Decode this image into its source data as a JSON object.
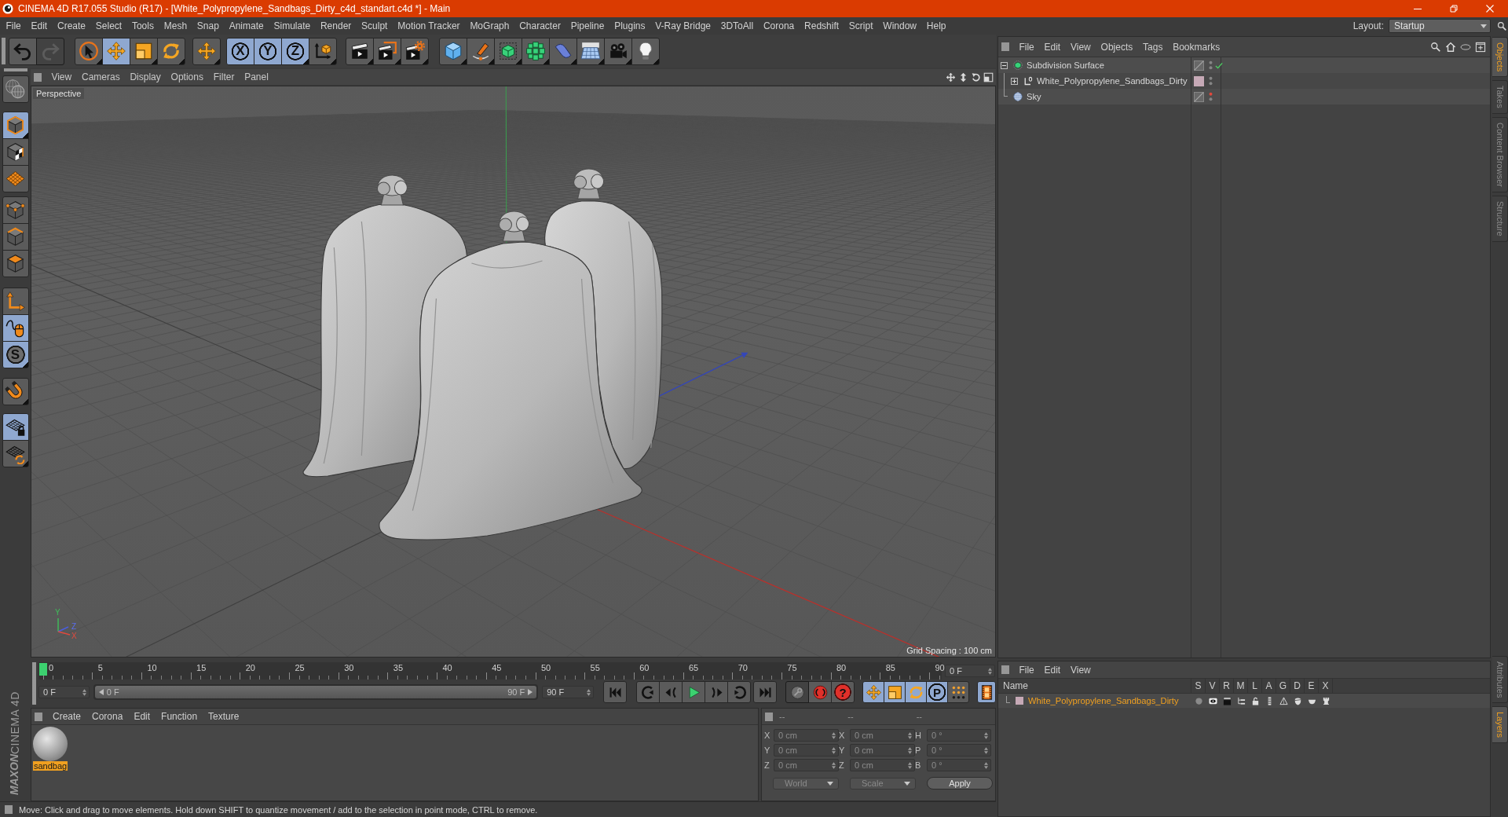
{
  "window": {
    "title": "CINEMA 4D R17.055 Studio (R17) - [White_Polypropylene_Sandbags_Dirty_c4d_standart.c4d *] - Main"
  },
  "menu_bar": {
    "items": [
      "File",
      "Edit",
      "Create",
      "Select",
      "Tools",
      "Mesh",
      "Snap",
      "Animate",
      "Simulate",
      "Render",
      "Sculpt",
      "Motion Tracker",
      "MoGraph",
      "Character",
      "Pipeline",
      "Plugins",
      "V-Ray Bridge",
      "3DToAll",
      "Corona",
      "Redshift",
      "Script",
      "Window",
      "Help"
    ],
    "layout_label": "Layout:",
    "layout_value": "Startup"
  },
  "toolbar": {
    "groups": [
      {
        "buttons": [
          {
            "disabled": false
          },
          {
            "disabled": true
          }
        ]
      },
      {
        "buttons": [
          {
            "selected": false
          },
          {
            "selected": true
          },
          {
            "selected": false
          },
          {
            "selected": false
          }
        ]
      },
      {
        "buttons": [
          {
            "selected": false
          }
        ]
      },
      {
        "buttons": [
          {
            "label": "X",
            "selected": true
          },
          {
            "label": "Y",
            "selected": true
          },
          {
            "label": "Z",
            "selected": true
          },
          {
            "selected": false
          }
        ]
      },
      {
        "buttons": [
          {
            "selected": false
          },
          {
            "selected": false
          },
          {
            "selected": false
          }
        ]
      },
      {
        "buttons": [
          {
            "selected": false
          },
          {
            "selected": false
          },
          {
            "selected": false
          },
          {
            "selected": false
          },
          {
            "selected": false
          },
          {
            "selected": false
          },
          {
            "selected": false
          },
          {
            "selected": false
          }
        ]
      }
    ]
  },
  "palette": {
    "groups": [
      {
        "buttons": [
          {
            "selected": false
          }
        ]
      },
      {
        "buttons": [
          {
            "selected": true
          },
          {
            "selected": false
          },
          {
            "selected": false
          }
        ]
      },
      {
        "buttons": [
          {
            "selected": false
          },
          {
            "selected": false
          },
          {
            "selected": false
          }
        ]
      },
      {
        "buttons": [
          {
            "selected": false
          },
          {
            "selected": true
          },
          {
            "label": "S",
            "selected": true
          }
        ]
      },
      {
        "buttons": [
          {
            "selected": false
          }
        ]
      },
      {
        "buttons": [
          {
            "selected": true
          },
          {
            "selected": false
          }
        ]
      }
    ]
  },
  "logo": {
    "brand": "MAXON",
    "product": "CINEMA 4D"
  },
  "viewport": {
    "menu": [
      "View",
      "Cameras",
      "Display",
      "Options",
      "Filter",
      "Panel"
    ],
    "camera": "Perspective",
    "grid_spacing": "Grid Spacing : 100 cm",
    "axis_labels": [
      "Y",
      "Z",
      "X"
    ]
  },
  "timeline": {
    "ticks": [
      "0",
      "5",
      "10",
      "15",
      "20",
      "25",
      "30",
      "35",
      "40",
      "45",
      "50",
      "55",
      "60",
      "65",
      "70",
      "75",
      "80",
      "85",
      "90"
    ],
    "playhead": {
      "level": 0
    },
    "frame": "0 F"
  },
  "playback": {
    "current": "0 F",
    "range": {
      "start": "0 F",
      "end": "90 F",
      "level": 1
    },
    "end": "90 F",
    "record": [
      {
        "disabled": true
      },
      {
        "disabled": false
      },
      {
        "label": "?",
        "disabled": false
      }
    ],
    "modes": [
      {
        "selected": true
      },
      {
        "selected": true
      },
      {
        "selected": true
      },
      {
        "label": "P",
        "selected": true
      },
      {
        "selected": false
      }
    ],
    "timeline_toggle": {
      "selected": true
    }
  },
  "materials": {
    "menu": [
      "Create",
      "Corona",
      "Edit",
      "Function",
      "Texture"
    ],
    "items": [
      {
        "name": "sandbag",
        "selected": true
      }
    ]
  },
  "coordinates": {
    "headers": [
      "--",
      "--",
      "--"
    ],
    "rows": [
      {
        "pos_axis": "X",
        "pos": "0 cm",
        "size_axis": "X",
        "size": "0 cm",
        "rot_axis": "H",
        "rot": "0 °"
      },
      {
        "pos_axis": "Y",
        "pos": "0 cm",
        "size_axis": "Y",
        "size": "0 cm",
        "rot_axis": "P",
        "rot": "0 °"
      },
      {
        "pos_axis": "Z",
        "pos": "0 cm",
        "size_axis": "Z",
        "size": "0 cm",
        "rot_axis": "B",
        "rot": "0 °"
      }
    ],
    "space": "World",
    "mode": "Scale",
    "apply": "Apply"
  },
  "object_manager": {
    "menu": [
      "File",
      "Edit",
      "View",
      "Objects",
      "Tags",
      "Bookmarks"
    ],
    "objects": [
      {
        "kind": "generator",
        "name": "Subdivision Surface",
        "expanded": true,
        "enabled": true,
        "editor_hidden": false,
        "children": [
          {
            "kind": "mesh",
            "name": "White_Polypropylene_Sandbags_Dirty",
            "expanded": false,
            "color": "#c6a9b6",
            "editor_hidden": false
          }
        ]
      },
      {
        "kind": "sky",
        "name": "Sky",
        "editor_hidden": true
      }
    ]
  },
  "layer_manager": {
    "menu": [
      "File",
      "Edit",
      "View"
    ],
    "columns": [
      "Name",
      "S",
      "V",
      "R",
      "M",
      "L",
      "A",
      "G",
      "D",
      "E",
      "X"
    ],
    "layers": [
      {
        "name": "White_Polypropylene_Sandbags_Dirty",
        "color": "#c6a9b6",
        "selected": true
      }
    ]
  },
  "side_tabs": {
    "upper": [
      {
        "label": "Objects",
        "selected": true
      },
      {
        "label": "Takes",
        "selected": false
      },
      {
        "label": "Content Browser",
        "selected": false
      },
      {
        "label": "Structure",
        "selected": false
      }
    ],
    "lower": [
      {
        "label": "Attributes",
        "selected": false
      },
      {
        "label": "Layers",
        "selected": true
      }
    ]
  },
  "status_bar": {
    "text": "Move: Click and drag to move elements. Hold down SHIFT to quantize movement / add to the selection in point mode, CTRL to remove."
  }
}
